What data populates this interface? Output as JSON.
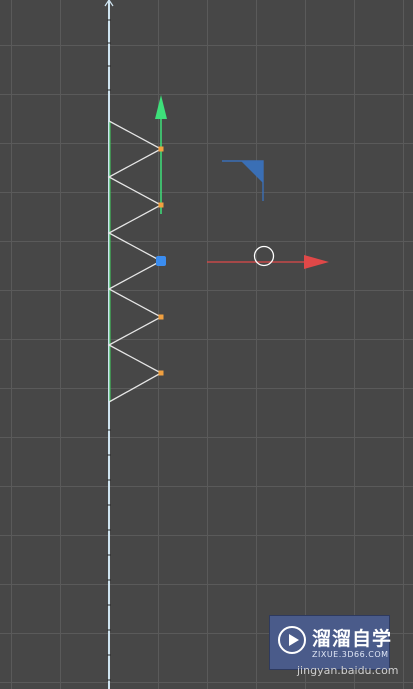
{
  "viewport": {
    "label": "3D viewport",
    "colors": {
      "background": "#474747",
      "grid": "#5a5a5a",
      "spline": "#e6e6e6",
      "spline_axis": "#3fbf5a",
      "y_axis": "#3ee07a",
      "x_axis": "#e04848",
      "z_handle": "#3a6fb5",
      "selected_point": "#3b8df0",
      "points": "#f0a040",
      "world_axis": "#cfe4f0"
    }
  },
  "gizmo": {
    "y_axis_arrow": "green-arrow-icon",
    "x_axis_arrow": "red-arrow-icon",
    "z_handle": "blue-plane-icon",
    "cursor": "circle-cursor-icon"
  },
  "watermark": {
    "title": "溜溜自学",
    "url": "ZIXUE.3D66.COM",
    "jingyan": "jingyan.baidu.com",
    "icon": "play-icon"
  }
}
